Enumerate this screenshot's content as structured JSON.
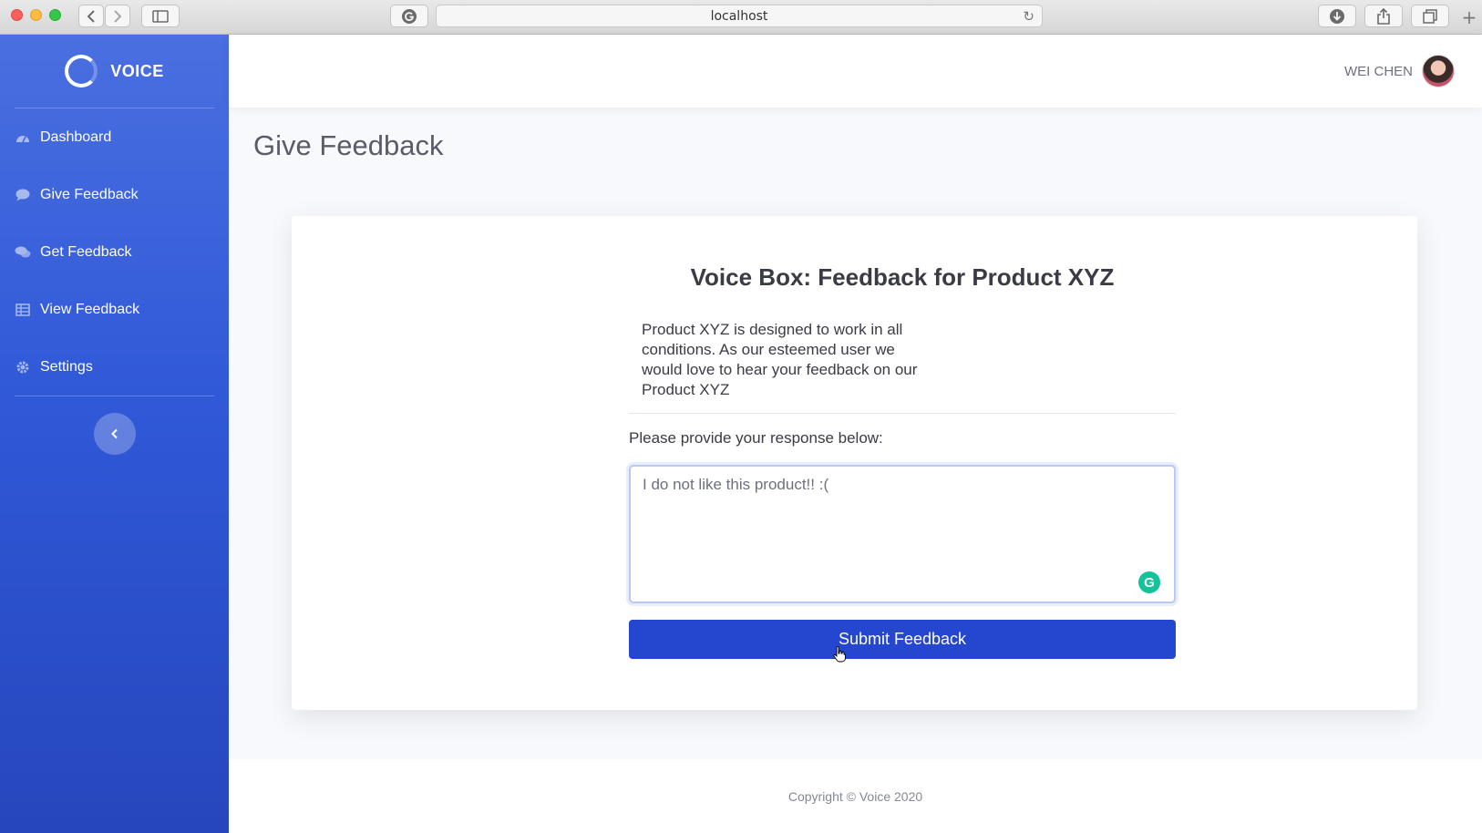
{
  "browser": {
    "url": "localhost",
    "icons": {
      "back": "chevron-left-icon",
      "forward": "chevron-right-icon",
      "sidebar": "sidebar-icon",
      "extension": "grammarly-icon",
      "reload": "reload-icon",
      "download": "download-icon",
      "share": "share-icon",
      "tabs": "tabs-icon",
      "new_tab": "plus-icon"
    }
  },
  "brand": {
    "name": "VOICE"
  },
  "sidebar": {
    "items": [
      {
        "label": "Dashboard",
        "icon": "dashboard-icon"
      },
      {
        "label": "Give Feedback",
        "icon": "comment-icon"
      },
      {
        "label": "Get Feedback",
        "icon": "comments-icon"
      },
      {
        "label": "View Feedback",
        "icon": "table-icon"
      },
      {
        "label": "Settings",
        "icon": "gear-icon"
      }
    ],
    "collapse_icon": "chevron-left-icon"
  },
  "topbar": {
    "user_name": "WEI CHEN"
  },
  "page": {
    "title": "Give Feedback"
  },
  "card": {
    "heading": "Voice Box: Feedback for Product XYZ",
    "description": "Product XYZ is designed to work in all conditions. As our esteemed user we would love to hear your feedback on our Product XYZ",
    "prompt": "Please provide your response below:",
    "response_value": "I do not like this product!! :(",
    "submit_label": "Submit Feedback"
  },
  "footer": {
    "copyright": "Copyright © Voice 2020"
  },
  "colors": {
    "sidebar": "#3059d8",
    "primary_button": "#2547d0",
    "grammarly": "#15c39a"
  }
}
